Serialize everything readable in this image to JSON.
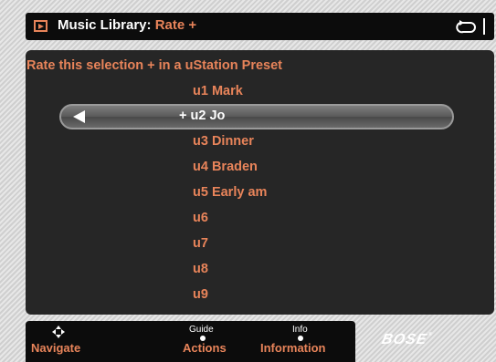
{
  "header": {
    "title": "Music Library:",
    "subtitle": "Rate +",
    "icon": "play-icon",
    "back_icon": "back-icon"
  },
  "prompt": "Rate this selection + in a uStation Preset",
  "presets": [
    {
      "label": "u1 Mark"
    },
    {
      "label": "+ u2 Jo",
      "selected": true
    },
    {
      "label": "u3 Dinner"
    },
    {
      "label": "u4 Braden"
    },
    {
      "label": "u5 Early am"
    },
    {
      "label": "u6"
    },
    {
      "label": "u7"
    },
    {
      "label": "u8"
    },
    {
      "label": "u9"
    }
  ],
  "footer": {
    "navigate": "Navigate",
    "actions_hint": "Guide",
    "actions": "Actions",
    "info_hint": "Info",
    "information": "Information"
  },
  "brand": "BOSE",
  "colors": {
    "accent": "#e8845a",
    "panel": "#262626",
    "bar": "#0c0c0c",
    "text_light": "#ffffff"
  }
}
